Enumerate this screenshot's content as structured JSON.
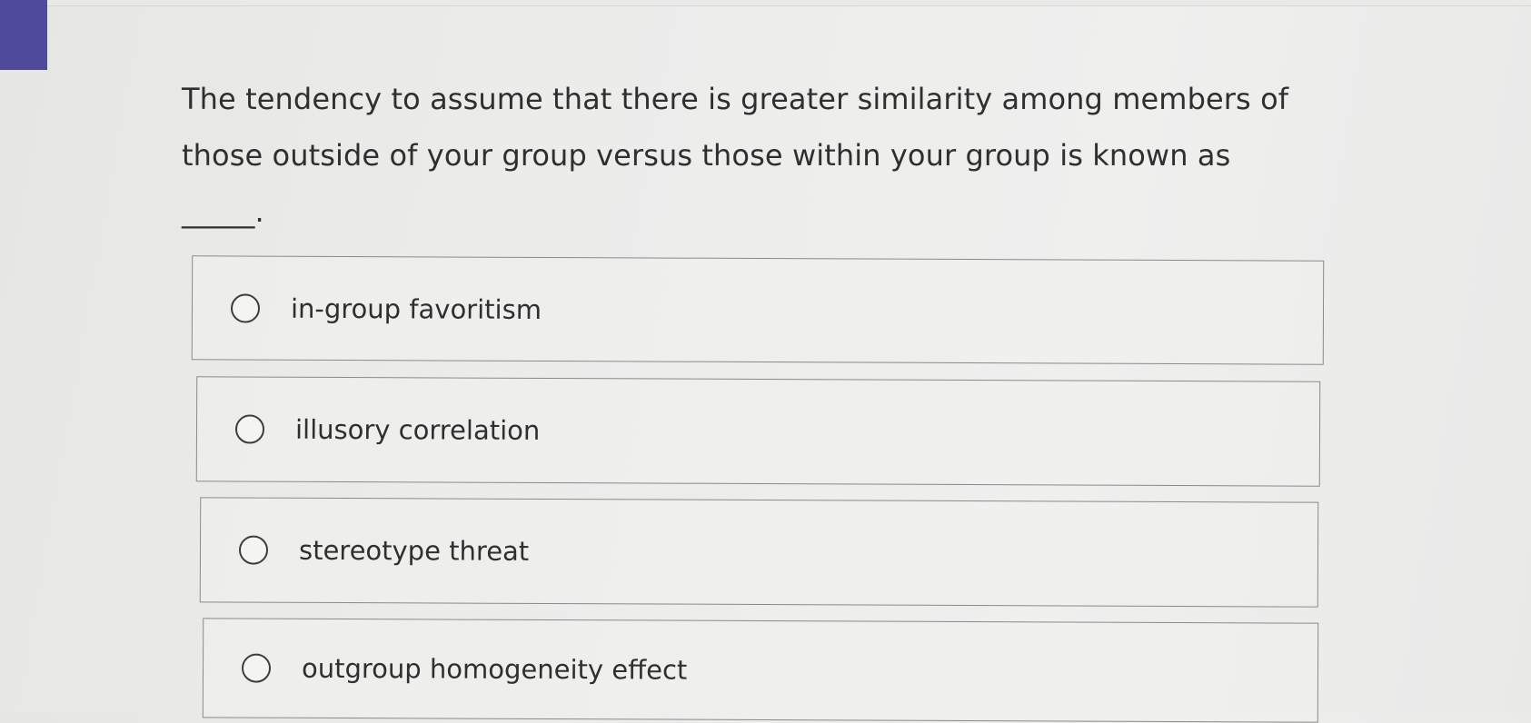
{
  "question": {
    "line1": "The tendency to assume that there is greater similarity among members of",
    "line2": "those outside of your group versus those within your group is known as _____."
  },
  "options": [
    {
      "label": "in-group favoritism",
      "selected": false
    },
    {
      "label": "illusory correlation",
      "selected": false
    },
    {
      "label": "stereotype threat",
      "selected": false
    },
    {
      "label": "outgroup homogeneity effect",
      "selected": false
    }
  ],
  "colors": {
    "accent": "#4f4a9c",
    "text": "#2f2f2f",
    "option_border": "#8a8a88"
  },
  "icons": {
    "radio": "radio-unchecked-icon"
  }
}
